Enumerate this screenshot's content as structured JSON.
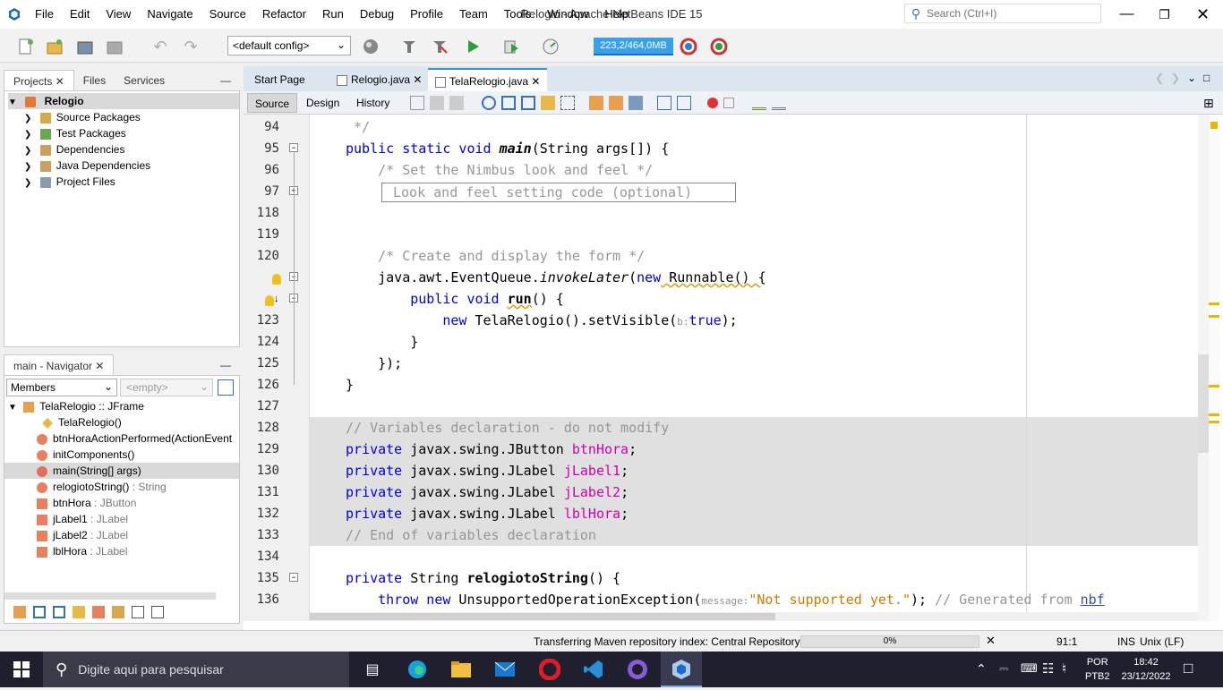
{
  "app": {
    "title": "Relogio - Apache NetBeans IDE 15",
    "menu": [
      "File",
      "Edit",
      "View",
      "Navigate",
      "Source",
      "Refactor",
      "Run",
      "Debug",
      "Profile",
      "Team",
      "Tools",
      "Window",
      "Help"
    ],
    "search_placeholder": "Search (Ctrl+I)"
  },
  "toolbar": {
    "config": "<default config>",
    "memory": "223,2/464,0MB"
  },
  "projects_panel": {
    "tabs": [
      "Projects",
      "Files",
      "Services"
    ],
    "root": "Relogio",
    "items": [
      "Source Packages",
      "Test Packages",
      "Dependencies",
      "Java Dependencies",
      "Project Files"
    ]
  },
  "navigator": {
    "title": "main - Navigator",
    "filter": "Members",
    "empty": "<empty>",
    "root": "TelaRelogio :: JFrame",
    "members": [
      {
        "name": "TelaRelogio()",
        "type": ""
      },
      {
        "name": "btnHoraActionPerformed(ActionEvent",
        "type": ""
      },
      {
        "name": "initComponents()",
        "type": ""
      },
      {
        "name": "main(String[] args)",
        "type": ""
      },
      {
        "name": "relogiotoString()",
        "type": " : String"
      },
      {
        "name": "btnHora",
        "type": " : JButton"
      },
      {
        "name": "jLabel1",
        "type": " : JLabel"
      },
      {
        "name": "jLabel2",
        "type": " : JLabel"
      },
      {
        "name": "lblHora",
        "type": " : JLabel"
      }
    ]
  },
  "editor": {
    "tabs": [
      "Start Page",
      "Relogio.java",
      "TelaRelogio.java"
    ],
    "view_tabs": [
      "Source",
      "Design",
      "History"
    ],
    "line_numbers": [
      "94",
      "95",
      "96",
      "97",
      "118",
      "119",
      "120",
      "",
      "",
      "123",
      "124",
      "125",
      "126",
      "127",
      "128",
      "129",
      "130",
      "131",
      "132",
      "133",
      "134",
      "135",
      "136"
    ],
    "fold_box": "Look and feel setting code (optional)"
  },
  "code": {
    "l0": " */",
    "l1a": "public static void ",
    "l1b": "main",
    "l1c": "(String args[]) {",
    "l2": "    /* Set the Nimbus look and feel */",
    "l6": "    /* Create and display the form */",
    "l7a": "    java.awt.EventQueue.",
    "l7b": "invokeLater",
    "l7c": "(",
    "l7d": "new",
    "l7e": " Runnable() {",
    "l8a": "        public void ",
    "l8b": "run",
    "l8c": "() {",
    "l9a": "            ",
    "l9b": "new",
    "l9c": " TelaRelogio().setVisible(",
    "l9d": "b:",
    "l9e": "true",
    "l9f": ");",
    "l10": "        }",
    "l11": "    });",
    "l12": "}",
    "l14": "// Variables declaration - do not modify",
    "decl_kw": "private",
    "decl1_type": " javax.swing.JButton ",
    "decl1_name": "btnHora",
    "decl2_type": " javax.swing.JLabel ",
    "decl2_name": "jLabel1",
    "decl3_type": " javax.swing.JLabel ",
    "decl3_name": "jLabel2",
    "decl4_type": " javax.swing.JLabel ",
    "decl4_name": "lblHora",
    "semi": ";",
    "l19": "// End of variables declaration",
    "l21a": "private",
    "l21b": " String ",
    "l21c": "relogiotoString",
    "l21d": "() {",
    "l22a": "    ",
    "l22b": "throw new",
    "l22c": " UnsupportedOperationException(",
    "l22d": "message:",
    "l22e": "\"Not supported yet.\"",
    "l22f": "); ",
    "l22g": "// Generated from ",
    "l22h": "nbf"
  },
  "status": {
    "message": "Transferring Maven repository index: Central Repository",
    "progress": "0%",
    "position": "91:1",
    "mode": "INS",
    "line_endings": "Unix (LF)"
  },
  "taskbar": {
    "search_placeholder": "Digite aqui para pesquisar",
    "lang": "POR",
    "layout": "PTB2",
    "time": "18:42",
    "date": "23/12/2022"
  },
  "colors": {
    "keyword": "#0000e6",
    "comment": "#969696",
    "field": "#d000b0",
    "string": "#ce7b00",
    "guarded_bg": "#e0e0e0",
    "taskbar": "#1f1f2e"
  }
}
